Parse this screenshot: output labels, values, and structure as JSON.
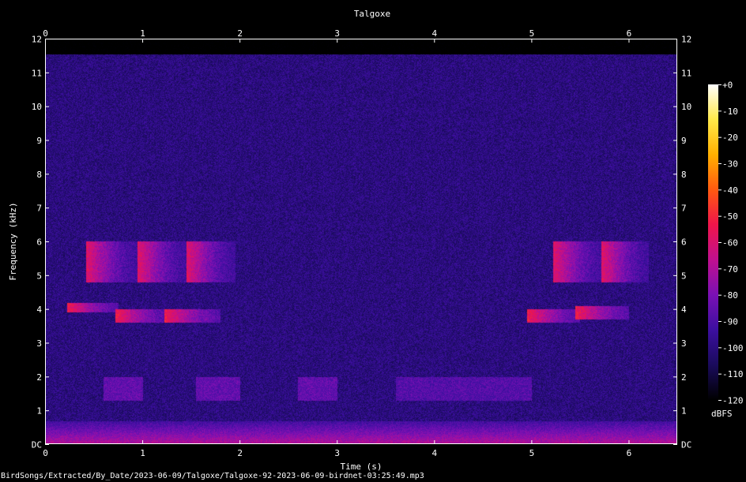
{
  "chart_data": {
    "type": "heatmap",
    "title": "Talgoxe",
    "xlabel": "Time (s)",
    "ylabel": "Frequency (kHz)",
    "xlim": [
      0,
      6.5
    ],
    "ylim": [
      0,
      12
    ],
    "x_ticks": [
      "0",
      "1",
      "2",
      "3",
      "4",
      "5",
      "6"
    ],
    "y_ticks": [
      "DC",
      "1",
      "2",
      "3",
      "4",
      "5",
      "6",
      "7",
      "8",
      "9",
      "10",
      "11",
      "12"
    ],
    "colorbar": {
      "unit": "dBFS",
      "range": [
        -120,
        0
      ],
      "ticks": [
        "+0",
        "-10",
        "-20",
        "-30",
        "-40",
        "-50",
        "-60",
        "-70",
        "-80",
        "-90",
        "-100",
        "-110",
        "-120"
      ],
      "colors": [
        "#000000",
        "#1a0b5c",
        "#3c0fa0",
        "#7a10b4",
        "#c0108f",
        "#f0154a",
        "#ff5a10",
        "#ffb000",
        "#ffe94a",
        "#ffffff"
      ]
    },
    "background_level_dbfs": -100,
    "events": [
      {
        "kind": "upper",
        "t_start": 0.42,
        "t_end": 0.95,
        "f_low": 4.8,
        "f_high": 6.0,
        "level_dbfs": -58
      },
      {
        "kind": "upper",
        "t_start": 0.95,
        "t_end": 1.45,
        "f_low": 4.8,
        "f_high": 6.0,
        "level_dbfs": -58
      },
      {
        "kind": "upper",
        "t_start": 1.45,
        "t_end": 1.95,
        "f_low": 4.8,
        "f_high": 6.0,
        "level_dbfs": -58
      },
      {
        "kind": "upper",
        "t_start": 5.22,
        "t_end": 5.75,
        "f_low": 4.8,
        "f_high": 6.0,
        "level_dbfs": -58
      },
      {
        "kind": "upper",
        "t_start": 5.72,
        "t_end": 6.2,
        "f_low": 4.8,
        "f_high": 6.0,
        "level_dbfs": -58
      },
      {
        "kind": "lower",
        "t_start": 0.22,
        "t_end": 0.75,
        "f_low": 3.9,
        "f_high": 4.2,
        "level_dbfs": -52
      },
      {
        "kind": "lower",
        "t_start": 0.72,
        "t_end": 1.25,
        "f_low": 3.6,
        "f_high": 4.0,
        "level_dbfs": -52
      },
      {
        "kind": "lower",
        "t_start": 1.22,
        "t_end": 1.8,
        "f_low": 3.6,
        "f_high": 4.0,
        "level_dbfs": -52
      },
      {
        "kind": "lower",
        "t_start": 4.95,
        "t_end": 5.5,
        "f_low": 3.6,
        "f_high": 4.0,
        "level_dbfs": -52
      },
      {
        "kind": "lower",
        "t_start": 5.45,
        "t_end": 6.0,
        "f_low": 3.7,
        "f_high": 4.1,
        "level_dbfs": -52
      },
      {
        "kind": "faint",
        "t_start": 0.6,
        "t_end": 1.0,
        "f_low": 1.3,
        "f_high": 2.0,
        "level_dbfs": -85
      },
      {
        "kind": "faint",
        "t_start": 1.55,
        "t_end": 2.0,
        "f_low": 1.3,
        "f_high": 2.0,
        "level_dbfs": -85
      },
      {
        "kind": "faint",
        "t_start": 2.6,
        "t_end": 3.0,
        "f_low": 1.3,
        "f_high": 2.0,
        "level_dbfs": -85
      },
      {
        "kind": "faint",
        "t_start": 3.6,
        "t_end": 5.0,
        "f_low": 1.3,
        "f_high": 2.0,
        "level_dbfs": -88
      }
    ],
    "low_frequency_band": {
      "f_low": 0,
      "f_high": 0.7,
      "level_dbfs": -68
    }
  },
  "footer": {
    "file_path": "BirdSongs/Extracted/By_Date/2023-06-09/Talgoxe/Talgoxe-92-2023-06-09-birdnet-03:25:49.mp3"
  }
}
